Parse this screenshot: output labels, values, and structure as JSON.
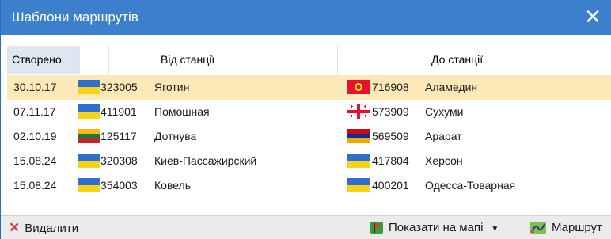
{
  "window": {
    "title": "Шаблони маршрутів"
  },
  "columns": {
    "created": "Створено",
    "from_station": "Від станції",
    "to_station": "До станції"
  },
  "rows": [
    {
      "date": "30.10.17",
      "from_flag": "ukraine",
      "from_code": "323005",
      "from_name": "Яготин",
      "to_flag": "kyrgyzstan",
      "to_code": "716908",
      "to_name": "Аламедин",
      "selected": true
    },
    {
      "date": "07.11.17",
      "from_flag": "ukraine",
      "from_code": "411901",
      "from_name": "Помошная",
      "to_flag": "georgia",
      "to_code": "573909",
      "to_name": "Сухуми",
      "selected": false
    },
    {
      "date": "02.10.19",
      "from_flag": "lithuania",
      "from_code": "125117",
      "from_name": "Дотнува",
      "to_flag": "armenia",
      "to_code": "569509",
      "to_name": "Арарат",
      "selected": false
    },
    {
      "date": "15.08.24",
      "from_flag": "ukraine",
      "from_code": "320308",
      "from_name": "Киев-Пассажирский",
      "to_flag": "ukraine",
      "to_code": "417804",
      "to_name": "Херсон",
      "selected": false
    },
    {
      "date": "15.08.24",
      "from_flag": "ukraine",
      "from_code": "354003",
      "from_name": "Ковель",
      "to_flag": "ukraine",
      "to_code": "400201",
      "to_name": "Одесса-Товарная",
      "selected": false
    }
  ],
  "toolbar": {
    "delete_label": "Видалити",
    "show_map_label": "Показати на мапі",
    "route_label": "Маршрут"
  },
  "colors": {
    "titlebar": "#3b7fcd",
    "selected_row": "#fde9b7",
    "header_sorted": "#dde6f1"
  }
}
